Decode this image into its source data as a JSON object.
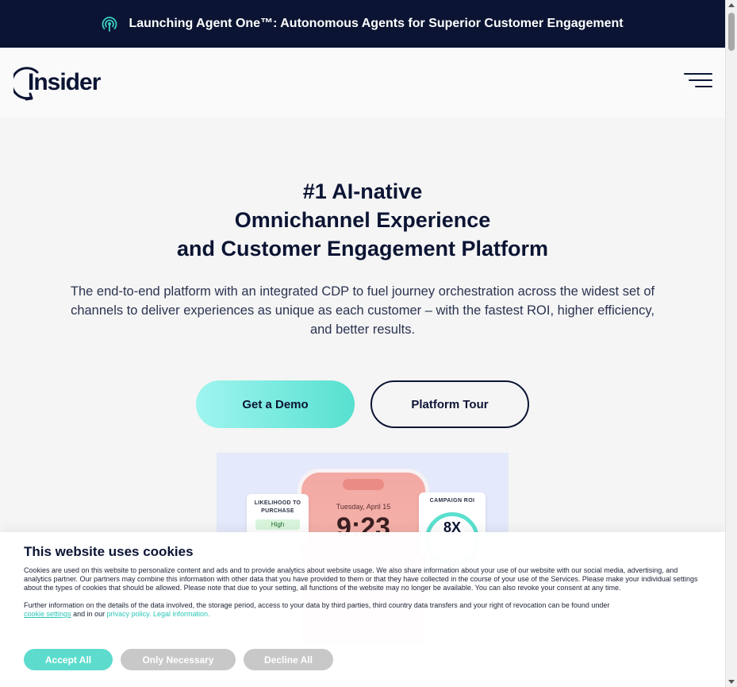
{
  "announcement": {
    "icon": "broadcast-icon",
    "text": "Launching Agent One™: Autonomous Agents for Superior Customer Engagement"
  },
  "header": {
    "logo_text": "Insider",
    "menu_icon": "hamburger-menu-icon"
  },
  "hero": {
    "title_line1": "#1 AI-native",
    "title_line2": "Omnichannel Experience",
    "title_line3": "and Customer Engagement Platform",
    "subtitle": "The end-to-end platform with an integrated CDP to fuel journey orchestration across the widest set of channels to deliver experiences as unique as each customer – with the fastest ROI, higher efficiency, and better results.",
    "cta_primary": "Get a Demo",
    "cta_secondary": "Platform Tour"
  },
  "product_image": {
    "likelihood_label_1": "LIKELIHOOD TO",
    "likelihood_label_2": "PURCHASE",
    "likelihood_value": "High",
    "phone_date": "Tuesday, April 15",
    "phone_time": "9:23",
    "roi_label": "CAMPAIGN ROI",
    "roi_value": "8X"
  },
  "cookie_banner": {
    "title": "This website uses cookies",
    "body": "Cookies are used on this website to personalize content and ads and to provide analytics about website usage. We also share information about your use of our website with our social media, advertising, and analytics partner. Our partners may combine this information with other data that you have provided to them or that they have collected in the course of your use of the Services. Please make your individual settings about the types of cookies that should be allowed. Please note that due to your setting, all functions of the website may no longer be available. You can also revoke your consent at any time.",
    "further_info": "Further information on the details of the data involved, the storage period, access to your data by third parties, third country data transfers and your right of revocation can be found under",
    "cookie_settings_link": "cookie settings",
    "and_in_our": "and in our",
    "privacy_link": "privacy policy.",
    "legal_link": "Legal information.",
    "accept_all": "Accept All",
    "only_necessary": "Only Necessary",
    "decline_all": "Decline All"
  },
  "colors": {
    "navy": "#0b1433",
    "teal": "#5ddccd",
    "page_bg": "#f5f5f5"
  }
}
